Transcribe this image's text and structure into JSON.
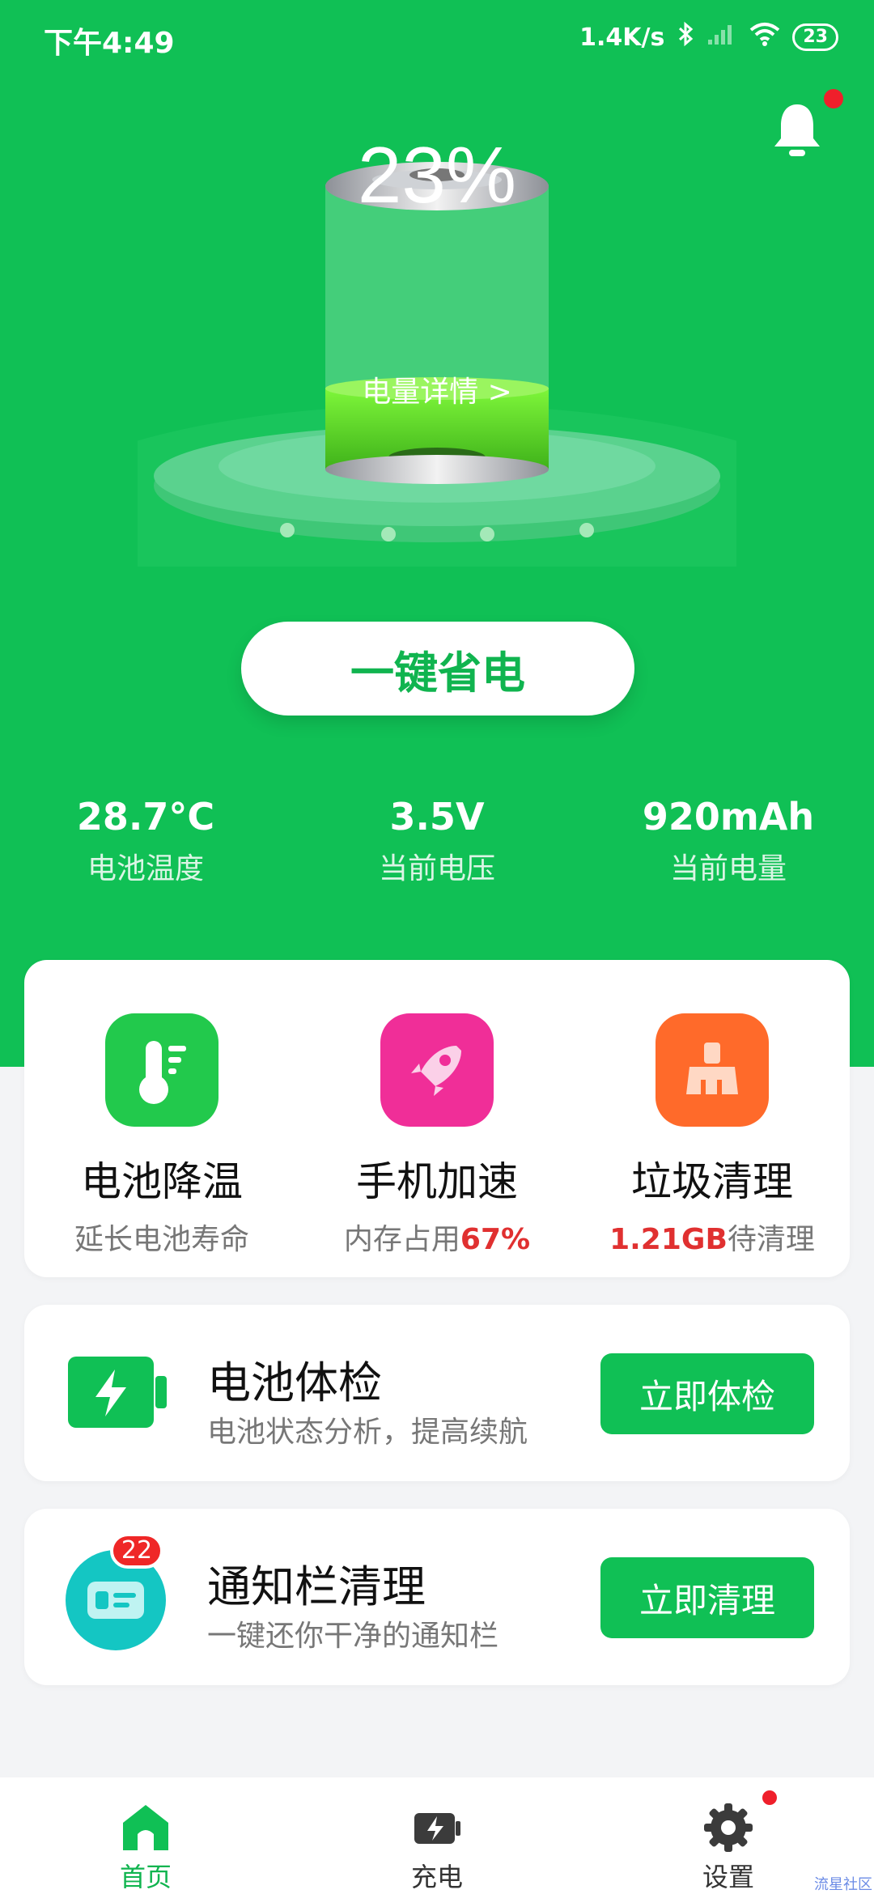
{
  "status_bar": {
    "time": "下午4:49",
    "network_speed": "1.4K/s",
    "battery": "23"
  },
  "hero": {
    "battery_percent": "23%",
    "detail_link": "电量详情 >",
    "save_button": "一键省电",
    "stats": [
      {
        "value": "28.7°C",
        "label": "电池温度"
      },
      {
        "value": "3.5V",
        "label": "当前电压"
      },
      {
        "value": "920mAh",
        "label": "当前电量"
      }
    ]
  },
  "tools": [
    {
      "name": "电池降温",
      "sub": "延长电池寿命",
      "icon": "thermometer-icon",
      "color": "#22c94c"
    },
    {
      "name": "手机加速",
      "sub_prefix": "内存占用",
      "sub_highlight": "67%",
      "icon": "rocket-icon",
      "color": "#f02e98"
    },
    {
      "name": "垃圾清理",
      "sub_highlight": "1.21GB",
      "sub_suffix": "待清理",
      "icon": "broom-icon",
      "color": "#ff6a2a"
    }
  ],
  "battery_check": {
    "title": "电池体检",
    "desc": "电池状态分析，提高续航",
    "button": "立即体检"
  },
  "notification_clean": {
    "title": "通知栏清理",
    "desc": "一键还你干净的通知栏",
    "button": "立即清理",
    "badge": "22"
  },
  "tabbar": [
    {
      "label": "首页",
      "icon": "home-icon",
      "active": true
    },
    {
      "label": "充电",
      "icon": "charge-icon",
      "active": false
    },
    {
      "label": "设置",
      "icon": "gear-icon",
      "active": false
    }
  ],
  "watermark": "流星社区",
  "colors": {
    "primary": "#10c055",
    "accent_red": "#e03030"
  }
}
